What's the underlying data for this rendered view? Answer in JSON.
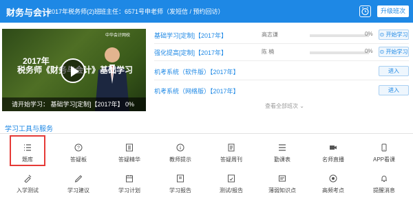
{
  "header": {
    "title": "财务与会计",
    "class_name": "2017年税务师(2)班",
    "teacher_info": "班主任：6571号申老师（发短信 / 预约回访）",
    "upgrade_label": "升级班次",
    "alarm_icon": "alarm-clock-icon"
  },
  "video": {
    "logo": "中华会计网校",
    "title_line1": "2017年",
    "title_line2": "税务师《财务与会计》基础学习",
    "caption": "请开始学习：  基础学习[定制]【2017年】  0%"
  },
  "courses": [
    {
      "name": "基础学习[定制]【2017年】",
      "teacher": "高志谦",
      "progress": "0%",
      "button": "开始学习"
    },
    {
      "name": "强化提高[定制]【2017年】",
      "teacher": "陈  楠",
      "progress": "0%",
      "button": "开始学习"
    },
    {
      "name": "机考系统（软件版）【2017年】",
      "teacher": "",
      "progress": "",
      "button": "进入"
    },
    {
      "name": "机考系统（网络版）【2017年】",
      "teacher": "",
      "progress": "",
      "button": "进入"
    }
  ],
  "more_link": "查看全部班次",
  "tools_section_title": "学习工具与服务",
  "tools_row1": [
    {
      "label": "题库",
      "icon": "list-icon"
    },
    {
      "label": "答疑板",
      "icon": "question-circle-icon"
    },
    {
      "label": "答疑精华",
      "icon": "book-icon"
    },
    {
      "label": "教师提示",
      "icon": "info-circle-icon"
    },
    {
      "label": "答疑周刊",
      "icon": "document-icon"
    },
    {
      "label": "勤课表",
      "icon": "menu-lines-icon"
    },
    {
      "label": "名师直播",
      "icon": "camera-icon"
    },
    {
      "label": "APP看课",
      "icon": "phone-icon"
    }
  ],
  "tools_row2": [
    {
      "label": "入学测试",
      "icon": "test-icon"
    },
    {
      "label": "学习建议",
      "icon": "suggestion-icon"
    },
    {
      "label": "学习计划",
      "icon": "plan-icon"
    },
    {
      "label": "学习报告",
      "icon": "report-icon"
    },
    {
      "label": "测试/报告",
      "icon": "exam-icon"
    },
    {
      "label": "薄弱知识点",
      "icon": "weak-point-icon"
    },
    {
      "label": "高频考点",
      "icon": "frequent-icon"
    },
    {
      "label": "提醒消息",
      "icon": "bell-icon"
    }
  ],
  "colors": {
    "primary": "#1e88e5",
    "highlight": "#e53935"
  }
}
